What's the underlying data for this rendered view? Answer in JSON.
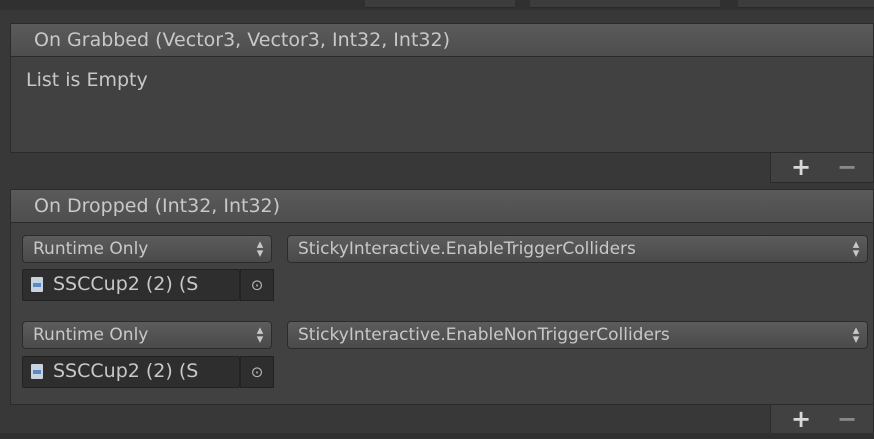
{
  "events": [
    {
      "title": "On Grabbed (Vector3, Vector3, Int32, Int32)",
      "empty_text": "List is Empty",
      "entries": []
    },
    {
      "title": "On Dropped (Int32, Int32)",
      "entries": [
        {
          "mode": "Runtime Only",
          "target": "SSCCup2 (2) (S",
          "function": "StickyInteractive.EnableTriggerColliders"
        },
        {
          "mode": "Runtime Only",
          "target": "SSCCup2 (2) (S",
          "function": "StickyInteractive.EnableNonTriggerColliders"
        }
      ]
    }
  ],
  "footer": {
    "add_label": "+",
    "remove_label": "−"
  },
  "icons": {
    "dropdown_arrow": "updown-arrow-icon",
    "object_picker": "target-circle-icon",
    "script_asset": "script-file-icon"
  },
  "colors": {
    "panel_bg": "#383838",
    "header_bg": "#555555",
    "body_bg": "#414141",
    "field_bg": "#2e2e2e",
    "text": "#c4c4c4"
  }
}
